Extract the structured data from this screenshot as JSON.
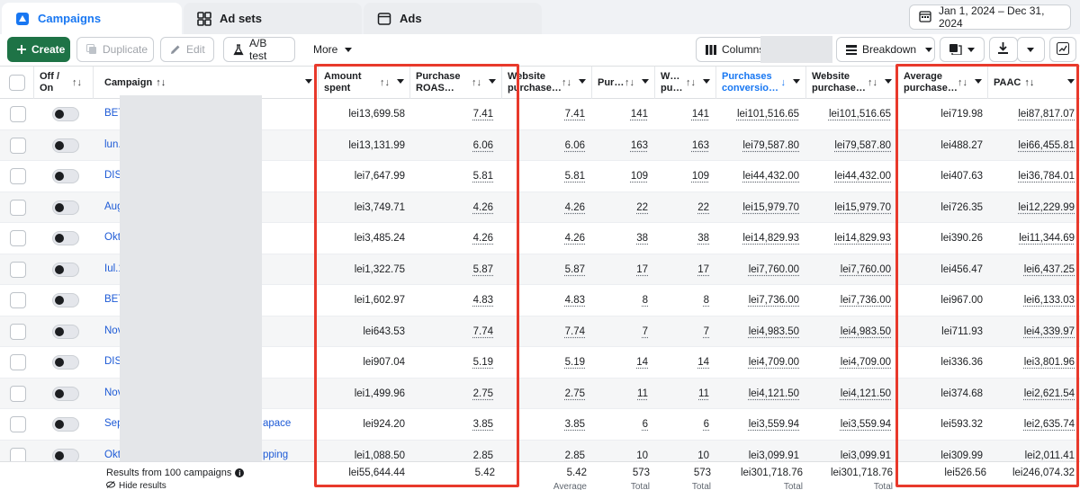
{
  "tabs": [
    {
      "label": "Campaigns",
      "icon": "campaigns-icon",
      "active": true
    },
    {
      "label": "Ad sets",
      "icon": "ad-sets-icon",
      "active": false
    },
    {
      "label": "Ads",
      "icon": "ads-icon",
      "active": false
    }
  ],
  "date_range": "Jan 1, 2024 – Dec 31, 2024",
  "toolbar": {
    "create": "Create",
    "duplicate": "Duplicate",
    "edit": "Edit",
    "ab_test": "A/B test",
    "more": "More",
    "columns": "Columns:",
    "breakdown": "Breakdown"
  },
  "headers": {
    "off_on_1": "Off /",
    "off_on_2": "On",
    "campaign": "Campaign",
    "amount_spent_1": "Amount",
    "amount_spent_2": "spent",
    "roas_1": "Purchase",
    "roas_2": "ROAS…",
    "website_roas_1": "Website",
    "website_roas_2": "purchase…",
    "purchases": "Pur…",
    "website_purchases_1": "W…",
    "website_purchases_2": "pu…",
    "conv_value_1": "Purchases",
    "conv_value_2": "conversio…",
    "website_conv_1": "Website",
    "website_conv_2": "purchase…",
    "avg_value_1": "Average",
    "avg_value_2": "purchase…",
    "paac": "PAAC"
  },
  "rows": [
    {
      "campaign": "BET",
      "suffix": "",
      "spent": "lei13,699.58",
      "roas": "7.41",
      "wroas": "7.41",
      "pur": "141",
      "wpur": "141",
      "conv": "lei101,516.65",
      "wconv": "lei101,516.65",
      "avg": "lei719.98",
      "paac": "lei87,817.07"
    },
    {
      "campaign": "lun.",
      "suffix": "",
      "spent": "lei13,131.99",
      "roas": "6.06",
      "wroas": "6.06",
      "pur": "163",
      "wpur": "163",
      "conv": "lei79,587.80",
      "wconv": "lei79,587.80",
      "avg": "lei488.27",
      "paac": "lei66,455.81"
    },
    {
      "campaign": "DIS",
      "suffix": "",
      "spent": "lei7,647.99",
      "roas": "5.81",
      "wroas": "5.81",
      "pur": "109",
      "wpur": "109",
      "conv": "lei44,432.00",
      "wconv": "lei44,432.00",
      "avg": "lei407.63",
      "paac": "lei36,784.01"
    },
    {
      "campaign": "Aug",
      "suffix": "",
      "spent": "lei3,749.71",
      "roas": "4.26",
      "wroas": "4.26",
      "pur": "22",
      "wpur": "22",
      "conv": "lei15,979.70",
      "wconv": "lei15,979.70",
      "avg": "lei726.35",
      "paac": "lei12,229.99"
    },
    {
      "campaign": "Okt",
      "suffix": "",
      "spent": "lei3,485.24",
      "roas": "4.26",
      "wroas": "4.26",
      "pur": "38",
      "wpur": "38",
      "conv": "lei14,829.93",
      "wconv": "lei14,829.93",
      "avg": "lei390.26",
      "paac": "lei11,344.69"
    },
    {
      "campaign": "Iul.1",
      "suffix": "",
      "spent": "lei1,322.75",
      "roas": "5.87",
      "wroas": "5.87",
      "pur": "17",
      "wpur": "17",
      "conv": "lei7,760.00",
      "wconv": "lei7,760.00",
      "avg": "lei456.47",
      "paac": "lei6,437.25"
    },
    {
      "campaign": "BET",
      "suffix": "",
      "spent": "lei1,602.97",
      "roas": "4.83",
      "wroas": "4.83",
      "pur": "8",
      "wpur": "8",
      "conv": "lei7,736.00",
      "wconv": "lei7,736.00",
      "avg": "lei967.00",
      "paac": "lei6,133.03"
    },
    {
      "campaign": "Nov",
      "suffix": "",
      "spent": "lei643.53",
      "roas": "7.74",
      "wroas": "7.74",
      "pur": "7",
      "wpur": "7",
      "conv": "lei4,983.50",
      "wconv": "lei4,983.50",
      "avg": "lei711.93",
      "paac": "lei4,339.97"
    },
    {
      "campaign": "DIS",
      "suffix": "",
      "spent": "lei907.04",
      "roas": "5.19",
      "wroas": "5.19",
      "pur": "14",
      "wpur": "14",
      "conv": "lei4,709.00",
      "wconv": "lei4,709.00",
      "avg": "lei336.36",
      "paac": "lei3,801.96"
    },
    {
      "campaign": "Nov",
      "suffix": "",
      "spent": "lei1,499.96",
      "roas": "2.75",
      "wroas": "2.75",
      "pur": "11",
      "wpur": "11",
      "conv": "lei4,121.50",
      "wconv": "lei4,121.50",
      "avg": "lei374.68",
      "paac": "lei2,621.54"
    },
    {
      "campaign": "Sep",
      "suffix": "apace",
      "spent": "lei924.20",
      "roas": "3.85",
      "wroas": "3.85",
      "pur": "6",
      "wpur": "6",
      "conv": "lei3,559.94",
      "wconv": "lei3,559.94",
      "avg": "lei593.32",
      "paac": "lei2,635.74"
    },
    {
      "campaign": "Okt",
      "suffix": "pping",
      "spent": "lei1,088.50",
      "roas": "2.85",
      "wroas": "2.85",
      "pur": "10",
      "wpur": "10",
      "conv": "lei3,099.91",
      "wconv": "lei3,099.91",
      "avg": "lei309.99",
      "paac": "lei2,011.41"
    }
  ],
  "footer": {
    "results": "Results from 100 campaigns",
    "hide": "Hide results",
    "spent": "lei55,644.44",
    "roas": "5.42",
    "wroas": "5.42",
    "wroas_sub": "Average",
    "pur": "573",
    "pur_sub": "Total",
    "wpur": "573",
    "wpur_sub": "Total",
    "conv": "lei301,718.76",
    "conv_sub": "Total",
    "wconv": "lei301,718.76",
    "wconv_sub": "Total",
    "avg": "lei526.56",
    "paac": "lei246,074.32"
  },
  "colors": {
    "accent": "#1877f2",
    "create": "#1e7346",
    "highlight": "#e8392b"
  }
}
